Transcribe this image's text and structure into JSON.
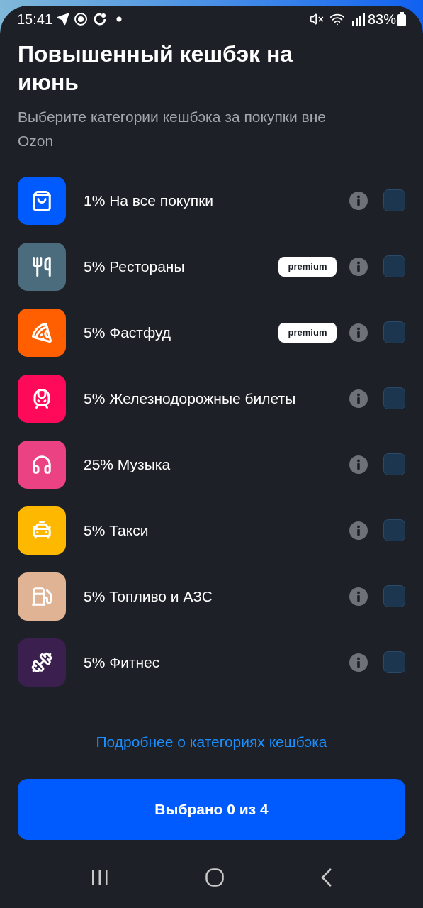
{
  "status_bar": {
    "time": "15:41",
    "battery": "83%"
  },
  "title": "Повышенный кешбэк на июнь",
  "subtitle": "Выберите категории кешбэка за покупки вне Ozon",
  "categories": [
    {
      "kind": "bag",
      "color": "#005bff",
      "label": "1% На все покупки",
      "checked": false
    },
    {
      "kind": "food",
      "color": "#4a6c7d",
      "label": "5% Рестораны",
      "badge": "premium",
      "checked": false
    },
    {
      "kind": "pizza",
      "color": "#ff5f00",
      "label": "5% Фастфуд",
      "badge": "premium",
      "checked": false
    },
    {
      "kind": "train",
      "color": "#ff0a5b",
      "label": "5% Железнодорожные билеты",
      "checked": false
    },
    {
      "kind": "music",
      "color": "#eb4284",
      "label": "25% Музыка",
      "checked": false
    },
    {
      "kind": "taxi",
      "color": "#ffb800",
      "label": "5% Такси",
      "checked": false
    },
    {
      "kind": "fuel",
      "color": "#e0b394",
      "label": "5% Топливо и АЗС",
      "checked": false
    },
    {
      "kind": "fitness",
      "color": "#3b1f4f",
      "label": "5% Фитнес",
      "checked": false
    }
  ],
  "link": "Подробнее о категориях кешбэка",
  "button": "Выбрано 0 из 4"
}
